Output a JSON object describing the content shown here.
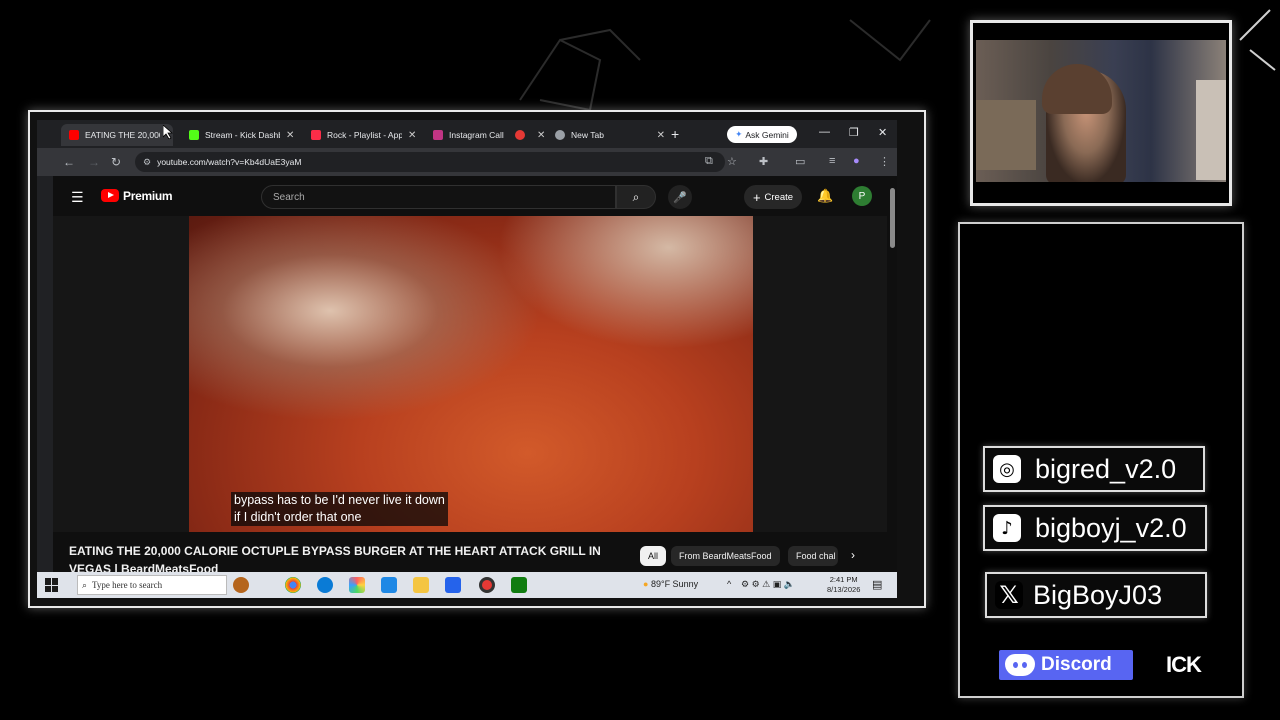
{
  "browser": {
    "tabs": [
      {
        "label": "EATING THE 20,000 C",
        "favicon_color": "#ff0000",
        "active": true
      },
      {
        "label": "Stream - Kick Dashbo",
        "favicon_color": "#53fc18",
        "active": false
      },
      {
        "label": "Rock - Playlist - Appl",
        "favicon_color": "#fa2d48",
        "active": false
      },
      {
        "label": "Instagram Call",
        "favicon_color": "#c13584",
        "active": false
      },
      {
        "label": "",
        "favicon_color": "#e53935",
        "active": false
      },
      {
        "label": "New Tab",
        "favicon_color": "#9aa0a6",
        "active": false
      }
    ],
    "new_tab_symbol": "+",
    "ask_gemini": "Ask Gemini",
    "url": "youtube.com/watch?v=Kb4dUaE3yaM"
  },
  "youtube": {
    "brand": "Premium",
    "search_placeholder": "Search",
    "create_label": "Create",
    "avatar_letter": "P",
    "caption_line1": "bypass has to be I'd never live it down",
    "caption_line2": "if I didn't order that one",
    "video_title": "EATING THE 20,000 CALORIE OCTUPLE BYPASS BURGER AT THE HEART ATTACK GRILL IN VEGAS | BeardMeatsFood",
    "chips": [
      "All",
      "From BeardMeatsFood",
      "Food chal"
    ]
  },
  "taskbar": {
    "search_placeholder": "Type here to search",
    "weather": "89°F  Sunny",
    "time": "2:41 PM",
    "date": "8/13/2026"
  },
  "socials": {
    "instagram": "bigred_v2.0",
    "tiktok": "bigboyj_v2.0",
    "x": "BigBoyJ03",
    "discord": "Discord",
    "kick": "ICK"
  },
  "icons": {
    "instagram": "instagram-icon",
    "tiktok": "tiktok-icon",
    "x": "x-icon",
    "discord": "discord-icon"
  }
}
